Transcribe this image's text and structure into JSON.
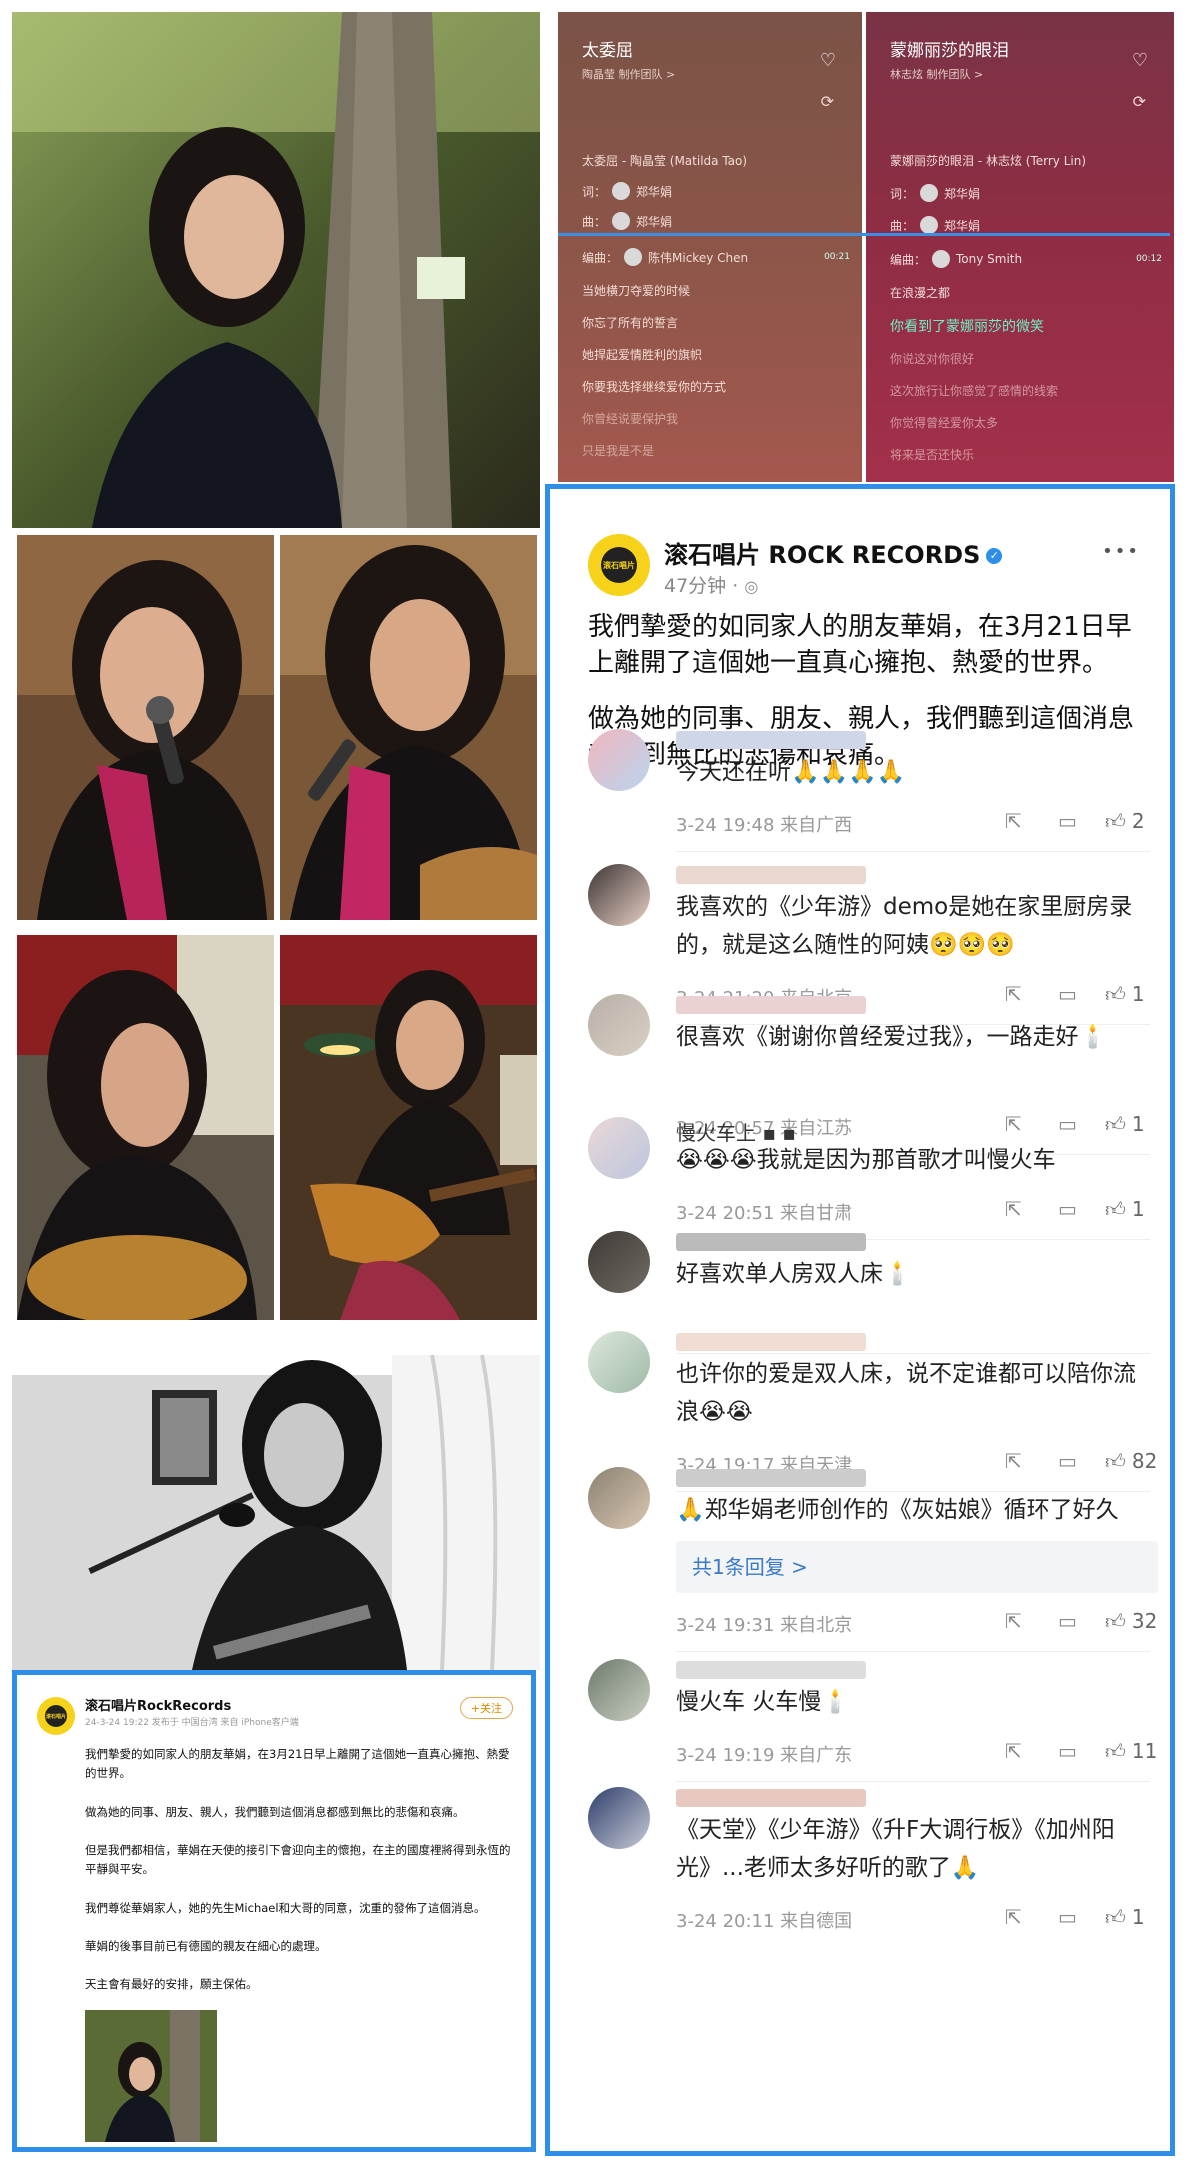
{
  "lyrics": {
    "left": {
      "title": "太委屈",
      "subtitle": "陶晶莹   制作团队 >",
      "song_line": "太委屈 - 陶晶莹 (Matilda Tao)",
      "lyricist": "词：",
      "lyricist_name": "郑华娟",
      "composer": "曲：",
      "composer_name": "郑华娟",
      "arranger": "编曲：",
      "arranger_name": "陈伟Mickey Chen",
      "time": "00:21",
      "lines": [
        "当她横刀夺爱的时候",
        "你忘了所有的誓言",
        "她捍起爱情胜利的旗帜",
        "你要我选择继续爱你的方式",
        "你曾经说要保护我",
        "只是我是不是"
      ]
    },
    "right": {
      "title": "蒙娜丽莎的眼泪",
      "subtitle": "林志炫   制作团队 >",
      "song_line": "蒙娜丽莎的眼泪 - 林志炫 (Terry Lin)",
      "lyricist": "词：",
      "lyricist_name": "郑华娟",
      "composer": "曲：",
      "composer_name": "郑华娟",
      "arranger": "编曲：",
      "arranger_name": "Tony Smith",
      "time": "00:12",
      "lines": [
        "在浪漫之都",
        "你看到了蒙娜丽莎的微笑",
        "你说这对你很好",
        "这次旅行让你感觉了感情的线索",
        "你觉得曾经爱你太多",
        "将来是否还快乐"
      ],
      "active_index": 1
    }
  },
  "post_right": {
    "name": "滚石唱片 ROCK RECORDS",
    "time": "47分钟 ·",
    "more": "•••",
    "text1": "我們摯愛的如同家人的朋友華娟，在3月21日早上離開了這個她一直真心擁抱、熱愛的世界。",
    "text2": "做為她的同事、朋友、親人，我們聽到這個消息都感到無比的悲傷和哀痛。",
    "logo_text": "滚石唱片"
  },
  "comments": [
    {
      "text": "今天还在听🙏🙏🙏🙏",
      "meta": "3-24 19:48  来自广西",
      "likes": "2"
    },
    {
      "text": "我喜欢的《少年游》demo是她在家里厨房录的，就是这么随性的阿姨🥺🥺🥺",
      "meta": "3-24 21:20  来自北京",
      "likes": "1"
    },
    {
      "text": "很喜欢《谢谢你曾经爱过我》，一路走好🕯️",
      "meta": "3-24 20:57  来自江苏",
      "likes": "1"
    },
    {
      "name": "慢火车上 ▪ ▪",
      "text": "😭😭😭我就是因为那首歌才叫慢火车",
      "meta": "3-24 20:51  来自甘肃",
      "likes": "1"
    },
    {
      "text": "好喜欢单人房双人床🕯️",
      "meta": "",
      "likes": ""
    },
    {
      "text": "也许你的爱是双人床，说不定谁都可以陪你流浪😭😭",
      "meta": "3-24 19:17  来自天津",
      "likes": "82"
    },
    {
      "text": "🙏郑华娟老师创作的《灰姑娘》循环了好久",
      "reply": "共1条回复 >",
      "meta": "3-24 19:31  来自北京",
      "likes": "32"
    },
    {
      "text": "慢火车 火车慢🕯️",
      "meta": "3-24 19:19  来自广东",
      "likes": "11"
    },
    {
      "text": "《天堂》《少年游》《升F大调行板》《加州阳光》...老师太多好听的歌了🙏",
      "meta": "3-24 20:11  来自德国",
      "likes": "1"
    }
  ],
  "post_left": {
    "name": "滚石唱片RockRecords",
    "meta": "24-3-24 19:22  发布于 中国台湾  来自 iPhone客户端",
    "follow": "+关注",
    "paragraphs": [
      "我們摯愛的如同家人的朋友華娟，在3月21日早上離開了這個她一直真心擁抱、熱愛的世界。",
      "做為她的同事、朋友、親人，我們聽到這個消息都感到無比的悲傷和哀痛。",
      "但是我們都相信，華娟在天使的接引下會迎向主的懷抱，在主的國度裡將得到永恆的平靜與平安。",
      "我們尊從華娟家人，她的先生Michael和大哥的同意，沈重的發佈了這個消息。",
      "華娟的後事目前已有德國的親友在細心的處理。",
      "天主會有最好的安排，願主保佑。"
    ],
    "logo_text": "滚石唱片"
  },
  "colors": {
    "blue_border": "#2f8fe8",
    "verify": "#2f8fe8",
    "lyric_active": "#6ff0c7",
    "logo_yellow": "#f6d21a"
  }
}
